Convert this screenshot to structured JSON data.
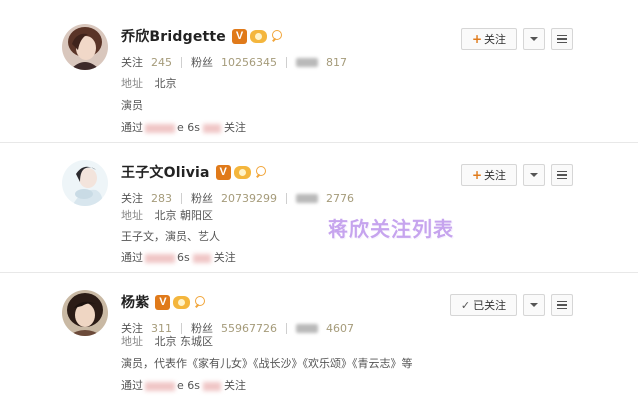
{
  "users": [
    {
      "name": "乔欣Bridgette",
      "verified_badge": "V",
      "following_label": "关注",
      "following_count": "245",
      "fans_label": "粉丝",
      "fans_count": "10256345",
      "weibo_count": "817",
      "location_label": "地址",
      "location": "北京",
      "bio": "演员",
      "via_prefix": "通过",
      "via_device": "e 6s",
      "via_suffix": "关注",
      "button_label": "关注",
      "button_state": "follow"
    },
    {
      "name": "王子文Olivia",
      "verified_badge": "V",
      "following_label": "关注",
      "following_count": "283",
      "fans_label": "粉丝",
      "fans_count": "20739299",
      "weibo_count": "2776",
      "location_label": "地址",
      "location": "北京 朝阳区",
      "bio": "王子文，演员、艺人",
      "via_prefix": "通过",
      "via_device": "6s",
      "via_suffix": "关注",
      "button_label": "关注",
      "button_state": "follow"
    },
    {
      "name": "杨紫",
      "verified_badge": "V",
      "following_label": "关注",
      "following_count": "311",
      "fans_label": "粉丝",
      "fans_count": "55967726",
      "weibo_count": "4607",
      "location_label": "地址",
      "location": "北京 东城区",
      "bio": "演员，代表作《家有儿女》《战长沙》《欢乐颂》《青云志》等",
      "via_prefix": "通过",
      "via_device": "e 6s",
      "via_suffix": "关注",
      "button_label": "已关注",
      "button_state": "followed"
    }
  ],
  "overlay_text": "蒋欣关注列表",
  "colors": {
    "badge_orange": "#e07a1a",
    "count_color": "#a59b7a",
    "overlay_purple": "#c6a4ee"
  }
}
